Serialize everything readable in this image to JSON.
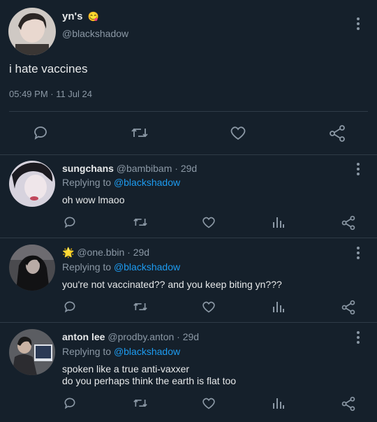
{
  "main_tweet": {
    "display_name": "yn's",
    "emoji": "😋",
    "handle": "@blackshadow",
    "text": "i hate vaccines",
    "timestamp": "05:49 PM · 11 Jul 24"
  },
  "replies": [
    {
      "display_name": "sungchans",
      "handle": "@bambibam",
      "age": "· 29d",
      "replying_prefix": "Replying to",
      "replying_to": "@blackshadow",
      "text_lines": [
        "oh wow lmaoo"
      ]
    },
    {
      "display_name": "",
      "name_emoji": "🌟",
      "handle": "@one.bbin",
      "age": "· 29d",
      "replying_prefix": "Replying to",
      "replying_to": "@blackshadow",
      "text_lines": [
        "you're not vaccinated?? and you keep biting yn???"
      ]
    },
    {
      "display_name": "anton lee",
      "handle": "@prodby.anton",
      "age": "· 29d",
      "replying_prefix": "Replying to",
      "replying_to": "@blackshadow",
      "text_lines": [
        "spoken like a true anti-vaxxer",
        "do you perhaps think the earth is flat too"
      ]
    }
  ],
  "colors": {
    "background": "#15202b",
    "text": "#e7e9ea",
    "muted": "#8b98a5",
    "link": "#1d9bf0"
  }
}
